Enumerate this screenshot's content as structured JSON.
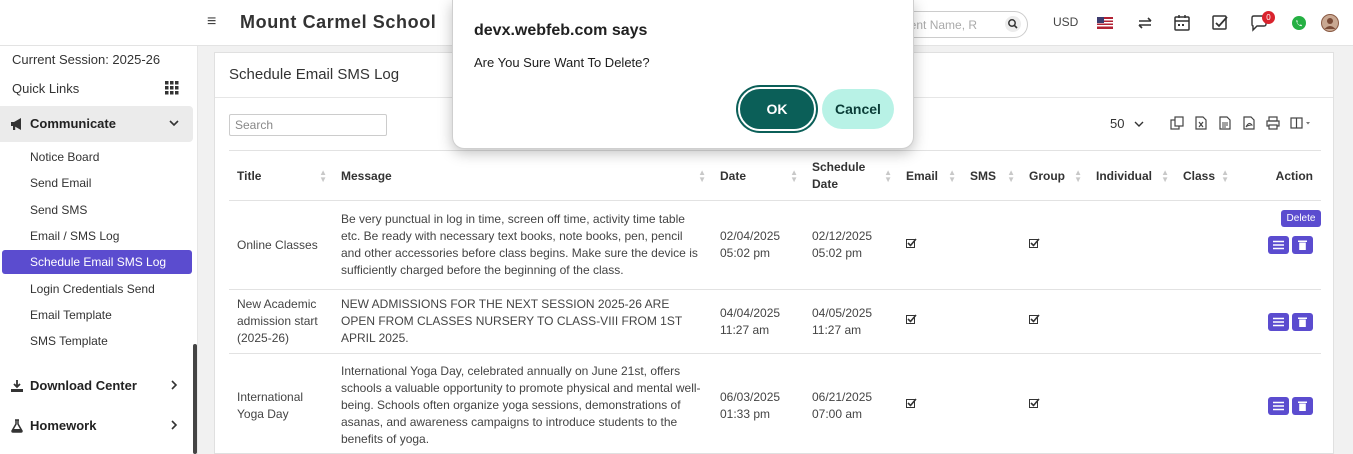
{
  "topbar": {
    "school_name": "Mount Carmel School",
    "search_placeholder": "dent Name, R",
    "currency": "USD",
    "notification_count": "0"
  },
  "sidebar": {
    "session": "Current Session: 2025-26",
    "quick_links": "Quick Links",
    "communicate": "Communicate",
    "items": [
      {
        "label": "Notice Board"
      },
      {
        "label": "Send Email"
      },
      {
        "label": "Send SMS"
      },
      {
        "label": "Email / SMS Log"
      },
      {
        "label": "Schedule Email SMS Log"
      },
      {
        "label": "Login Credentials Send"
      },
      {
        "label": "Email Template"
      },
      {
        "label": "SMS Template"
      }
    ],
    "download_center": "Download Center",
    "homework": "Homework"
  },
  "main": {
    "title": "Schedule Email SMS Log",
    "search_placeholder": "Search",
    "page_size": "50",
    "columns": [
      "Title",
      "Message",
      "Date",
      "Schedule Date",
      "Email",
      "SMS",
      "Group",
      "Individual",
      "Class",
      "Action"
    ],
    "tooltip": "Delete",
    "rows": [
      {
        "title": "Online Classes",
        "message": "Be very punctual in log in time, screen off time, activity time table etc. Be ready with necessary text books, note books, pen, pencil and other accessories before class begins. Make sure the device is sufficiently charged before the beginning of the class.",
        "date": "02/04/2025 05:02 pm",
        "schedule_date": "02/12/2025 05:02 pm",
        "email": true,
        "group": true
      },
      {
        "title": "New Academic admission start (2025-26)",
        "message": "NEW ADMISSIONS FOR THE NEXT SESSION 2025-26 ARE OPEN FROM CLASSES NURSERY TO CLASS-VIII FROM 1ST APRIL 2025.",
        "date": "04/04/2025 11:27 am",
        "schedule_date": "04/05/2025 11:27 am",
        "email": true,
        "group": true
      },
      {
        "title": "International Yoga Day",
        "message": "International Yoga Day, celebrated annually on June 21st, offers schools a valuable opportunity to promote physical and mental well-being. Schools often organize yoga sessions, demonstrations of asanas, and awareness campaigns to introduce students to the benefits of yoga.",
        "date": "06/03/2025 01:33 pm",
        "schedule_date": "06/21/2025 07:00 am",
        "email": true,
        "group": true
      }
    ]
  },
  "dialog": {
    "title": "devx.webfeb.com says",
    "message": "Are You Sure Want To Delete?",
    "ok": "OK",
    "cancel": "Cancel"
  },
  "colors": {
    "accent": "#5b4ccf",
    "ok_button": "#0b5f58",
    "cancel_button": "#b8f2e6"
  }
}
